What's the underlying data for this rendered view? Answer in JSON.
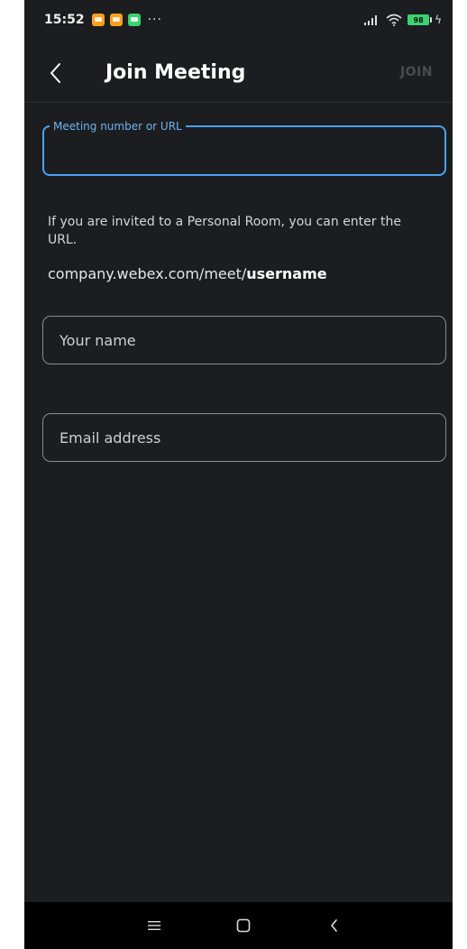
{
  "status_bar": {
    "time": "15:52",
    "more": "···",
    "battery": "98"
  },
  "header": {
    "title": "Join Meeting",
    "join_label": "JOIN"
  },
  "meeting_field": {
    "label": "Meeting number or URL",
    "value": ""
  },
  "hint": {
    "text": "If you are invited to a Personal Room, you can enter the URL.",
    "url_prefix": "company.webex.com/meet/",
    "url_bold": "username"
  },
  "name_field": {
    "placeholder": "Your name",
    "value": ""
  },
  "email_field": {
    "placeholder": "Email address",
    "value": ""
  },
  "colors": {
    "background": "#1c1d20",
    "accent": "#4aa3f0",
    "disabled": "#4a4b4f",
    "battery": "#3bd16f"
  },
  "icons": {
    "back": "chevron-left-icon",
    "nav_menu": "menu-icon",
    "nav_home": "home-square-icon",
    "nav_back": "nav-back-icon",
    "signal": "signal-icon",
    "wifi": "wifi-icon",
    "charging": "charging-bolt-icon"
  }
}
